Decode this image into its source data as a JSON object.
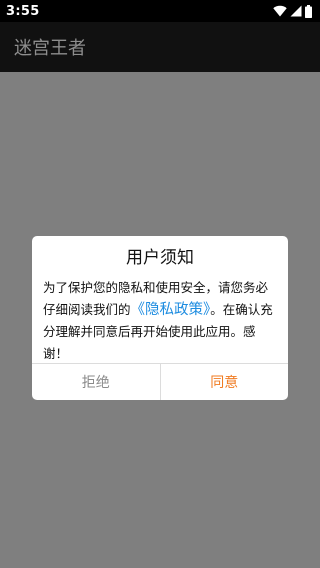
{
  "status_bar": {
    "time": "3:55",
    "icons": [
      "wifi-icon",
      "signal-icon",
      "battery-icon"
    ]
  },
  "app_bar": {
    "title": "迷宫王者"
  },
  "dialog": {
    "title": "用户须知",
    "message_before": "为了保护您的隐私和使用安全，请您务必仔细阅读我们的",
    "policy_link": "《隐私政策》",
    "message_after": "。在确认充分理解并同意后再开始使用此应用。感谢！",
    "reject_label": "拒绝",
    "agree_label": "同意"
  },
  "colors": {
    "overlay": "#7f7f7f",
    "app_bar": "#111111",
    "link": "#1d8ce0",
    "agree": "#f07b22",
    "reject": "#8a8a8a"
  }
}
